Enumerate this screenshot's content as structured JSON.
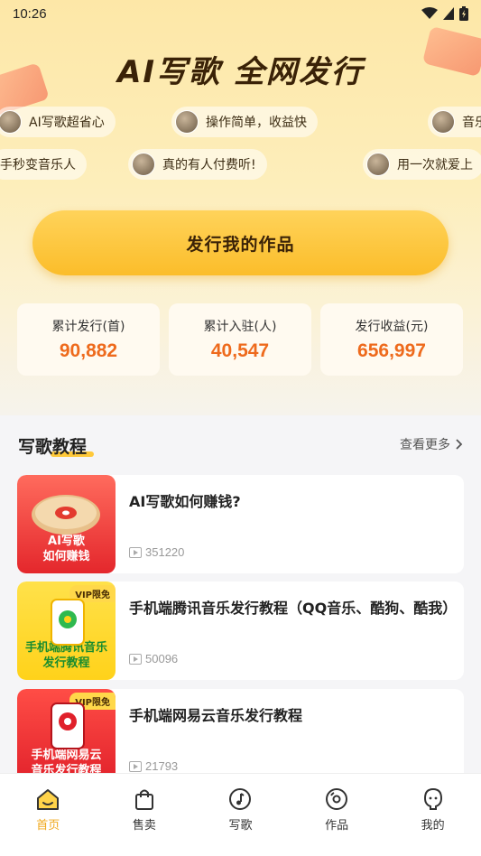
{
  "status_bar": {
    "time": "10:26"
  },
  "hero": {
    "headline": "AI写歌 全网发行",
    "chips_row1": [
      "AI写歌超省心",
      "操作简单，收益快",
      "音乐"
    ],
    "chips_row2": [
      "手秒变音乐人",
      "真的有人付费听!",
      "用一次就爱上"
    ],
    "publish_button": "发行我的作品"
  },
  "stats": [
    {
      "label": "累计发行(首)",
      "value": "90,882"
    },
    {
      "label": "累计入驻(人)",
      "value": "40,547"
    },
    {
      "label": "发行收益(元)",
      "value": "656,997"
    }
  ],
  "tutorials": {
    "title": "写歌教程",
    "see_more": "查看更多",
    "items": [
      {
        "title": "AI写歌如何赚钱?",
        "views": "351220",
        "thumb_text": "AI写歌\n如何赚钱",
        "vip": ""
      },
      {
        "title": "手机端腾讯音乐发行教程（QQ音乐、酷狗、酷我）",
        "views": "50096",
        "thumb_text": "手机端腾讯音乐\n发行教程",
        "vip": "VIP限免"
      },
      {
        "title": "手机端网易云音乐发行教程",
        "views": "21793",
        "thumb_text": "手机端网易云\n音乐发行教程",
        "vip": "VIP限免"
      }
    ]
  },
  "tabbar": {
    "items": [
      {
        "label": "首页",
        "icon": "home-icon",
        "active": true
      },
      {
        "label": "售卖",
        "icon": "shopping-bag-icon",
        "active": false
      },
      {
        "label": "写歌",
        "icon": "music-note-icon",
        "active": false
      },
      {
        "label": "作品",
        "icon": "disc-icon",
        "active": false
      },
      {
        "label": "我的",
        "icon": "profile-icon",
        "active": false
      }
    ]
  },
  "colors": {
    "accent": "#f0a81b",
    "stat_value": "#ee6a1c",
    "button": "#fbbd2a"
  }
}
